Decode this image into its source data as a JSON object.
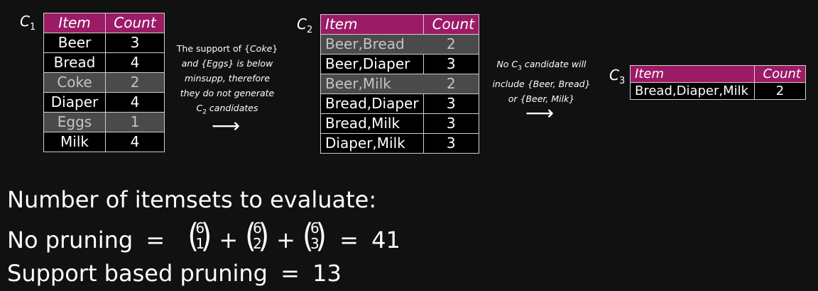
{
  "c1": {
    "label": "C",
    "sub": "1",
    "headers": [
      "Item",
      "Count"
    ],
    "rows": [
      {
        "item": "Beer",
        "count": "3",
        "pruned": false
      },
      {
        "item": "Bread",
        "count": "4",
        "pruned": false
      },
      {
        "item": "Coke",
        "count": "2",
        "pruned": true
      },
      {
        "item": "Diaper",
        "count": "4",
        "pruned": false
      },
      {
        "item": "Eggs",
        "count": "1",
        "pruned": true
      },
      {
        "item": "Milk",
        "count": "4",
        "pruned": false
      }
    ]
  },
  "note1": {
    "l1a": "The support of {",
    "l1b": "Coke",
    "l1c": "}",
    "l2a": "and {",
    "l2b": "Eggs",
    "l2c": "} is below",
    "l3": "minsupp, therefore",
    "l4": "they do not generate",
    "l5a": "C",
    "l5sub": "2",
    "l5b": " candidates"
  },
  "c2": {
    "label": "C",
    "sub": "2",
    "headers": [
      "Item",
      "Count"
    ],
    "rows": [
      {
        "item": "Beer,Bread",
        "count": "2",
        "pruned": true
      },
      {
        "item": "Beer,Diaper",
        "count": "3",
        "pruned": false
      },
      {
        "item": "Beer,Milk",
        "count": "2",
        "pruned": true
      },
      {
        "item": "Bread,Diaper",
        "count": "3",
        "pruned": false
      },
      {
        "item": "Bread,Milk",
        "count": "3",
        "pruned": false
      },
      {
        "item": "Diaper,Milk",
        "count": "3",
        "pruned": false
      }
    ]
  },
  "note2": {
    "l1a": "No C",
    "l1sub": "3",
    "l1b": " candidate will",
    "l2a": "include {",
    "l2b": "Beer",
    "l2c": ", ",
    "l2d": "Bread",
    "l2e": "}",
    "l3a": "or {",
    "l3b": "Beer",
    "l3c": ", ",
    "l3d": "Milk",
    "l3e": "}"
  },
  "arrow_glyph": "⟶",
  "c3": {
    "label": "C",
    "sub": "3",
    "headers": [
      "Item",
      "Count"
    ],
    "rows": [
      {
        "item": "Bread,Diaper,Milk",
        "count": "2",
        "pruned": false
      }
    ]
  },
  "summary": {
    "line1": "Number of itemsets to evaluate:",
    "line2_label": "No pruning",
    "eq": "=",
    "plus": "+",
    "binoms": [
      {
        "n": "6",
        "k": "1"
      },
      {
        "n": "6",
        "k": "2"
      },
      {
        "n": "6",
        "k": "3"
      }
    ],
    "line2_result": "41",
    "line3_label": "Support based pruning",
    "line3_result": "13"
  },
  "colors": {
    "header": "#9b1b67",
    "pruned_row": "#4a4a4a",
    "background": "#111111"
  }
}
